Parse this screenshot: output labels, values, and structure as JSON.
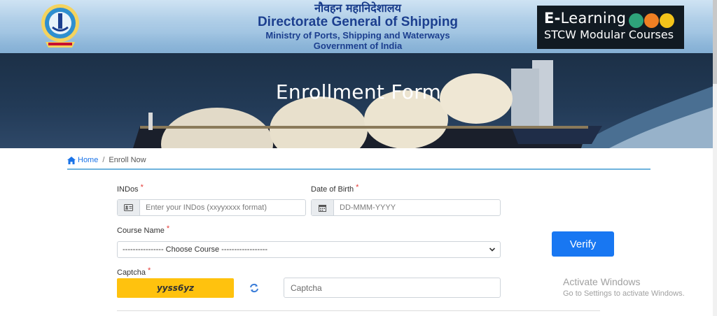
{
  "header": {
    "hindi_title": "नौवहन महानिदेशालय",
    "title": "Directorate General of Shipping",
    "ministry": "Ministry of Ports, Shipping and Waterways",
    "government": "Government of India",
    "elearning_title_bold": "E-",
    "elearning_title": "Learning",
    "elearning_subtitle": "STCW Modular Courses"
  },
  "banner": {
    "title": "Enrollment Form"
  },
  "breadcrumb": {
    "home": "Home",
    "separator": "/",
    "current": "Enroll Now"
  },
  "form": {
    "indos_label": "INDos",
    "indos_placeholder": "Enter your INDos (xxyyxxxx format)",
    "dob_label": "Date of Birth",
    "dob_placeholder": "DD-MMM-YYYY",
    "course_label": "Course Name",
    "course_selected": "---------------- Choose Course ------------------",
    "captcha_label": "Captcha",
    "captcha_text": "yyss6yz",
    "captcha_placeholder": "Captcha",
    "required_mark": "*",
    "verify_label": "Verify"
  },
  "os_overlay": {
    "line1": "Activate Windows",
    "line2": "Go to Settings to activate Windows."
  },
  "colors": {
    "primary": "#1877f2",
    "header_text": "#1c3f8f",
    "captcha_bg": "#ffc20e",
    "required": "#e53935",
    "rule": "#6fb3dd"
  }
}
